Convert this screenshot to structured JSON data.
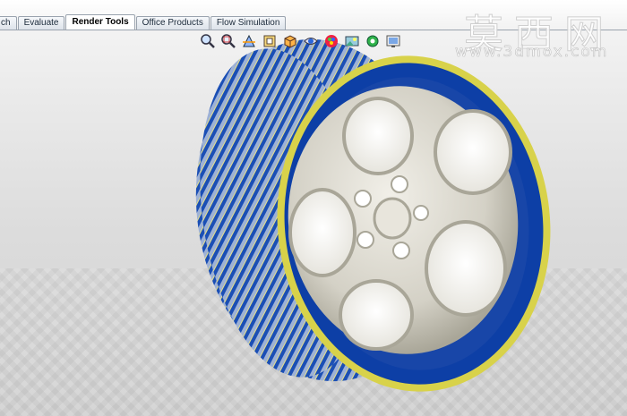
{
  "app": {
    "tabs": [
      {
        "label": "ch",
        "active": false
      },
      {
        "label": "Evaluate",
        "active": false
      },
      {
        "label": "Render Tools",
        "active": true
      },
      {
        "label": "Office Products",
        "active": false
      },
      {
        "label": "Flow Simulation",
        "active": false
      }
    ]
  },
  "toolbar": {
    "icons": [
      "zoom-to-fit-icon",
      "zoom-to-area-icon",
      "section-view-icon",
      "view-orientation-icon",
      "display-style-icon",
      "hide-show-items-icon",
      "edit-appearance-icon",
      "apply-scene-icon",
      "view-settings-icon",
      "render-icon"
    ]
  },
  "watermark": {
    "chinese": "莫西网",
    "url": "www.3dmox.com"
  },
  "scene": {
    "model": "wheel-with-tire",
    "colors": {
      "rim_band": "#0d3fa6",
      "tire_blue": "#1b4fb5",
      "tread_yellow": "#d8d24a",
      "hub": "#d9d6cc"
    }
  }
}
